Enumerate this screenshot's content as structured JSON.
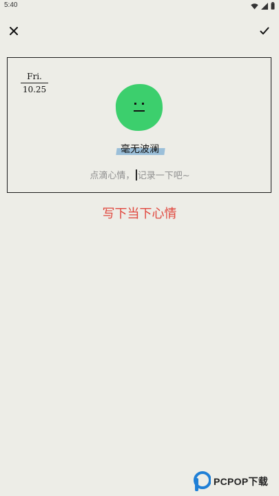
{
  "status_bar": {
    "time": "5:40"
  },
  "toolbar": {
    "close_icon": "close-icon",
    "confirm_icon": "check-icon"
  },
  "card": {
    "date": {
      "weekday": "Fri.",
      "day": "10.25"
    },
    "mood": {
      "icon": "neutral-face-icon",
      "color": "#3ccf6d",
      "label": "毫无波澜",
      "highlight_color": "#9bbfd9"
    },
    "diary": {
      "placeholder_before": "点滴心情，",
      "placeholder_after": "记录一下吧~"
    }
  },
  "hint": {
    "text": "写下当下心情",
    "color": "#e0463d"
  },
  "watermark": {
    "text": "PCPOP下载",
    "logo_color": "#1f7fd6"
  }
}
